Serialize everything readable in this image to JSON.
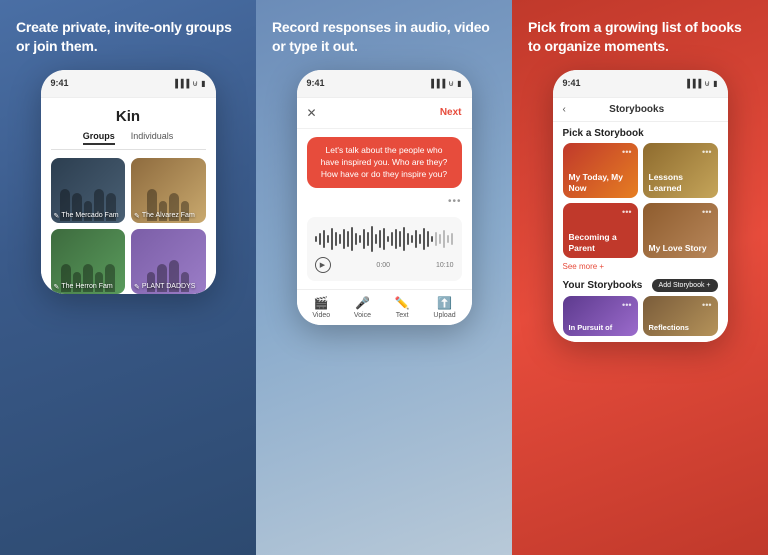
{
  "panels": [
    {
      "id": "panel-1",
      "title": "Create private, invite-only\ngroups or join them.",
      "phone": {
        "time": "9:41",
        "app_title": "Kin",
        "tabs": [
          "Groups",
          "Individuals"
        ],
        "active_tab": 0,
        "cards": [
          {
            "label": "The Mercado Fam",
            "bg": "card-bg-1"
          },
          {
            "label": "The Alvarez Fam",
            "bg": "card-bg-2"
          },
          {
            "label": "The Herron Fam",
            "bg": "card-bg-3"
          },
          {
            "label": "PLANT DADDYS",
            "bg": "card-bg-4"
          }
        ]
      }
    },
    {
      "id": "panel-2",
      "title": "Record responses in audio,\nvideo or type it out.",
      "phone": {
        "time": "9:41",
        "close_label": "✕",
        "next_label": "Next",
        "question": "Let's talk about the people who have\ninspired you. Who are they? How have or\ndo they inspire you?",
        "time_start": "0:00",
        "time_end": "10:10",
        "tools": [
          {
            "icon": "🎬",
            "label": "Video"
          },
          {
            "icon": "🎤",
            "label": "Voice"
          },
          {
            "icon": "✏️",
            "label": "Text"
          },
          {
            "icon": "⬆️",
            "label": "Upload"
          }
        ]
      }
    },
    {
      "id": "panel-3",
      "title": "Pick from a growing list of\nbooks to organize moments.",
      "phone": {
        "time": "9:41",
        "back_label": "‹",
        "header_title": "Storybooks",
        "section_title": "Pick a Storybook",
        "storybooks": [
          {
            "label": "My Today,\nMy Now",
            "bg": "sb-card-1"
          },
          {
            "label": "Lessons\nLearned",
            "bg": "sb-card-2"
          },
          {
            "label": "Becoming a\nParent",
            "bg": "sb-card-3"
          },
          {
            "label": "My Love\nStory",
            "bg": "sb-card-4"
          }
        ],
        "see_more": "See more +",
        "your_storybooks_title": "Your Storybooks",
        "add_button": "Add Storybook +",
        "bottom_cards": [
          {
            "label": "In Pursuit of",
            "bg": "pbc-1"
          },
          {
            "label": "Reflections",
            "bg": "pbc-2"
          }
        ]
      }
    }
  ]
}
